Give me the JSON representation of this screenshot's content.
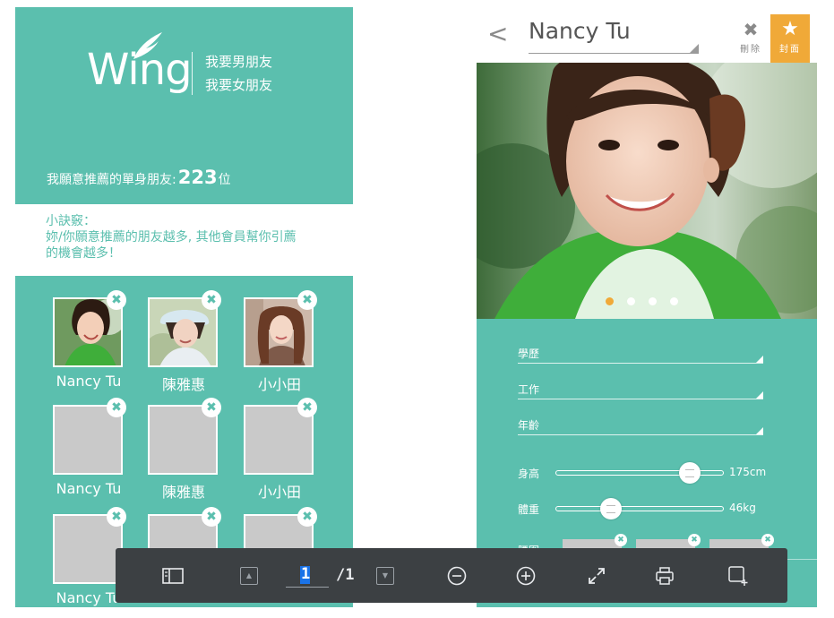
{
  "left_screen": {
    "logo": {
      "text": "Wing"
    },
    "header_links": [
      "我要男朋友",
      "我要女朋友"
    ],
    "recommend": {
      "prefix": "我願意推薦的單身朋友:",
      "count": "223",
      "suffix": "位"
    },
    "tips": {
      "title": "小訣竅：",
      "body_line1": "妳/你願意推薦的朋友越多, 其他會員幫你引薦",
      "body_line2": "的機會越多！"
    },
    "friends": [
      {
        "name": "Nancy Tu",
        "has_photo": true
      },
      {
        "name": "陳雅惠",
        "has_photo": true
      },
      {
        "name": "小小田",
        "has_photo": true
      },
      {
        "name": "Nancy Tu",
        "has_photo": false
      },
      {
        "name": "陳雅惠",
        "has_photo": false
      },
      {
        "name": "小小田",
        "has_photo": false
      },
      {
        "name": "Nancy Tu",
        "has_photo": false
      },
      {
        "name": "",
        "has_photo": false
      },
      {
        "name": "",
        "has_photo": false
      }
    ],
    "remove_glyph": "✖"
  },
  "right_screen": {
    "back_glyph": "<",
    "name_value": "Nancy Tu",
    "delete_button": {
      "icon": "✖",
      "label": "刪除"
    },
    "cover_button": {
      "icon": "★",
      "label": "封面"
    },
    "carousel": {
      "count": 4,
      "active_index": 0
    },
    "fields": [
      {
        "label": "學歷"
      },
      {
        "label": "工作"
      },
      {
        "label": "年齡"
      }
    ],
    "sliders": [
      {
        "label": "身高",
        "value": "175cm",
        "position": 0.8
      },
      {
        "label": "體重",
        "value": "46kg",
        "position": 0.33
      }
    ],
    "partial_label": "腰圍"
  },
  "pdf_toolbar": {
    "current_page": "1",
    "total_pages": "/1",
    "buttons": [
      "sidebar-toggle",
      "prev-page",
      "next-page",
      "zoom-out",
      "zoom-in",
      "fit-page",
      "print",
      "add-annotation"
    ]
  },
  "colors": {
    "teal": "#5bbfae",
    "accent_orange": "#f0a938",
    "toolbar_bg": "#3c4043",
    "placeholder_gray": "#c9c9c9"
  }
}
